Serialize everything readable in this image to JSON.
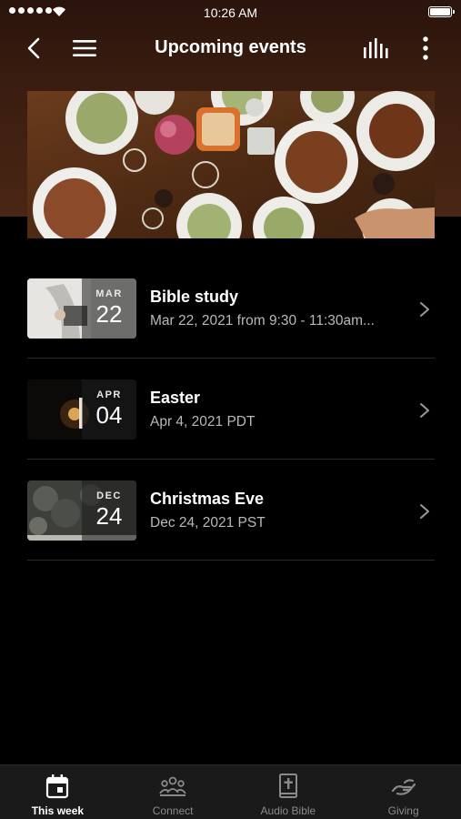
{
  "status": {
    "time": "10:26 AM"
  },
  "nav": {
    "title": "Upcoming events",
    "back_icon": "chevron-left-icon",
    "menu_icon": "hamburger-menu-icon",
    "audio_icon": "equalizer-bars-icon",
    "more_icon": "more-vertical-icon"
  },
  "events": [
    {
      "month": "MAR",
      "day": "22",
      "name": "Bible study",
      "when": "Mar 22, 2021 from 9:30 - 11:30am..."
    },
    {
      "month": "APR",
      "day": "04",
      "name": "Easter",
      "when": "Apr 4, 2021 PDT"
    },
    {
      "month": "DEC",
      "day": "24",
      "name": "Christmas Eve",
      "when": "Dec 24, 2021 PST"
    }
  ],
  "tabs": [
    {
      "label": "This week",
      "icon": "calendar-icon",
      "active": true
    },
    {
      "label": "Connect",
      "icon": "people-group-icon",
      "active": false
    },
    {
      "label": "Audio Bible",
      "icon": "bible-book-icon",
      "active": false
    },
    {
      "label": "Giving",
      "icon": "giving-hand-icon",
      "active": false
    }
  ],
  "colors": {
    "header_gradient": "#3a1d10",
    "background": "#000000",
    "tab_bar": "#1a1a1a",
    "secondary_text": "#b9b9b9"
  }
}
